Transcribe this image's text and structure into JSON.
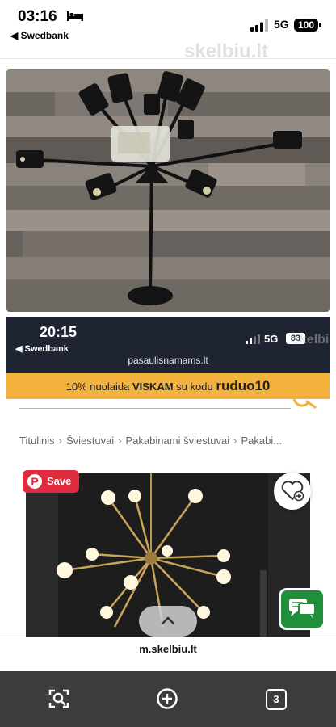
{
  "status_bar": {
    "time": "03:16",
    "back_app": "◀ Swedbank",
    "network": "5G",
    "battery": "100"
  },
  "watermark": "skelbiu.lt",
  "embedded_screenshot": {
    "status": {
      "time": "20:15",
      "back_app": "◀ Swedbank",
      "network": "5G",
      "battery": "83",
      "watermark": "skelbiu.lt"
    },
    "url": "pasaulisnamams.lt",
    "promo": {
      "text_before": "10% nuolaida ",
      "bold_word": "VISKAM",
      "text_middle": " su kodu ",
      "code": "ruduo10"
    },
    "breadcrumbs": [
      "Titulinis",
      "Šviestuvai",
      "Pakabinami šviestuvai",
      "Pakabi..."
    ],
    "breadcrumb_separator": "›",
    "pinterest_label": "Save"
  },
  "safari": {
    "url": "m.skelbiu.lt",
    "tab_count": "3"
  },
  "colors": {
    "promo": "#f3b23d",
    "pinterest": "#e02a3d",
    "chat": "#1f8f3c",
    "embedded_bar": "#1f2433",
    "toolbar": "#3c3c3e"
  }
}
